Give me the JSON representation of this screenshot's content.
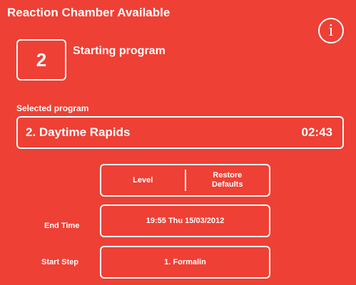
{
  "header": {
    "title": "Reaction Chamber Available",
    "info_icon": "info-icon",
    "info_glyph": "i"
  },
  "chamber": {
    "number": "2",
    "status": "Starting program"
  },
  "program": {
    "section_label": "Selected program",
    "name": "2. Daytime Rapids",
    "duration": "02:43"
  },
  "actions": {
    "level_label": "Level",
    "restore_line1": "Restore",
    "restore_line2": "Defaults"
  },
  "end_time": {
    "label": "End Time",
    "value": "19:55  Thu 15/03/2012"
  },
  "start_step": {
    "label": "Start Step",
    "value": "1. Formalin"
  }
}
